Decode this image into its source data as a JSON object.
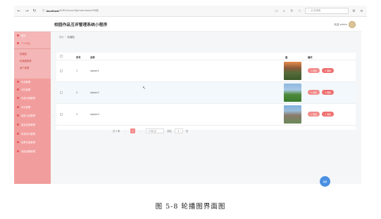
{
  "browser": {
    "url_prefix": "localhost",
    "url_path": ":8081/h/config/manubanp?ID册",
    "search_placeholder": "点击搜索",
    "icons": [
      "back-icon",
      "forward-icon",
      "reload-icon",
      "info-icon"
    ]
  },
  "header": {
    "title": "校园作品互评管理系统小程序",
    "user": "欢迎 admin"
  },
  "sidebar": {
    "items": [
      {
        "label": "首页"
      },
      {
        "label": "个人中心"
      },
      {
        "label": "轮播图"
      },
      {
        "label": "轮播图管理"
      },
      {
        "label": "用户管理"
      },
      {
        "label": "作品管理"
      },
      {
        "label": "评论管理"
      },
      {
        "label": "作品分类管理"
      },
      {
        "label": "评分管理"
      },
      {
        "label": "系统公告管理"
      },
      {
        "label": "留言反馈管理"
      },
      {
        "label": "作品评分管理"
      },
      {
        "label": "优秀作品管理"
      },
      {
        "label": "系统设置管理"
      }
    ]
  },
  "breadcrumb": {
    "home": "首页",
    "sep": "/",
    "current": "轮播图"
  },
  "table": {
    "headers": {
      "index": "序号",
      "name": "名称",
      "image": "值",
      "actions": "操作"
    },
    "rows": [
      {
        "index": "1",
        "name": "swiper1"
      },
      {
        "index": "2",
        "name": "swiper2"
      },
      {
        "index": "3",
        "name": "swiper3"
      }
    ],
    "edit_label": "修改",
    "delete_label": "删除"
  },
  "pagination": {
    "total": "共 3 条",
    "current": "1",
    "page_size": "10条/页",
    "goto_label": "前往",
    "goto_value": "1",
    "page_suffix": "页"
  },
  "fab_label": "客服",
  "caption": "图 5-8 轮播图界面图"
}
